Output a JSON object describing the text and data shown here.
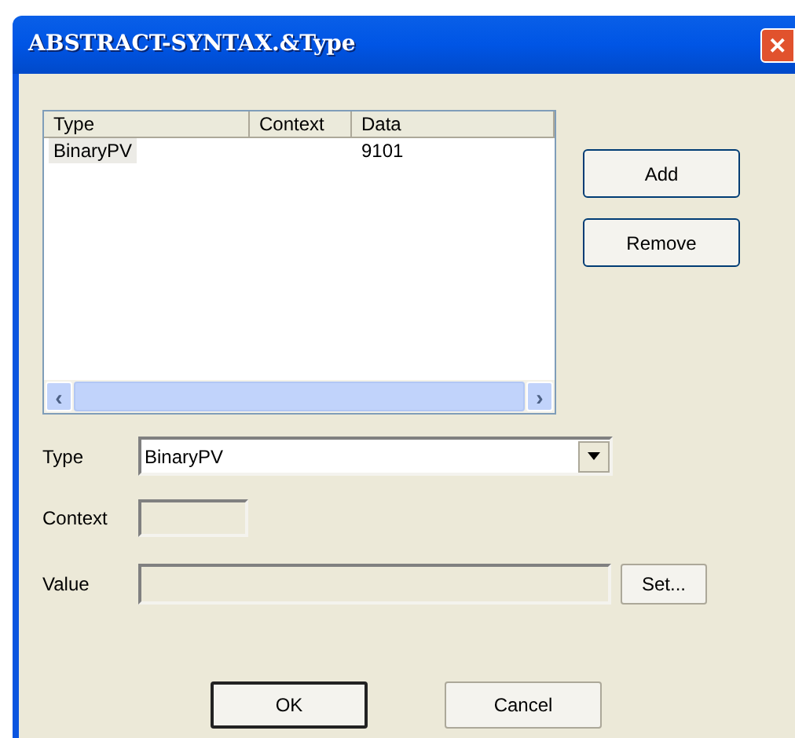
{
  "window": {
    "title": "ABSTRACT-SYNTAX.&Type",
    "close": "✕"
  },
  "list": {
    "columns": [
      "Type",
      "Context",
      "Data"
    ],
    "rows": [
      {
        "cells": [
          "BinaryPV",
          "",
          "9101"
        ],
        "selected": true
      }
    ],
    "scroll_left": "‹",
    "scroll_right": "›"
  },
  "side_buttons": [
    "Add",
    "Remove"
  ],
  "fields": [
    {
      "kind": "combo",
      "label": "Type",
      "value": "BinaryPV",
      "disabled": false
    },
    {
      "kind": "text",
      "label": "Context",
      "disabled": true
    },
    {
      "kind": "text_button",
      "label": "Value",
      "disabled": true,
      "button": "Set..."
    }
  ],
  "buttons": [
    {
      "label": "OK",
      "default": true
    },
    {
      "label": "Cancel",
      "default": false
    }
  ]
}
